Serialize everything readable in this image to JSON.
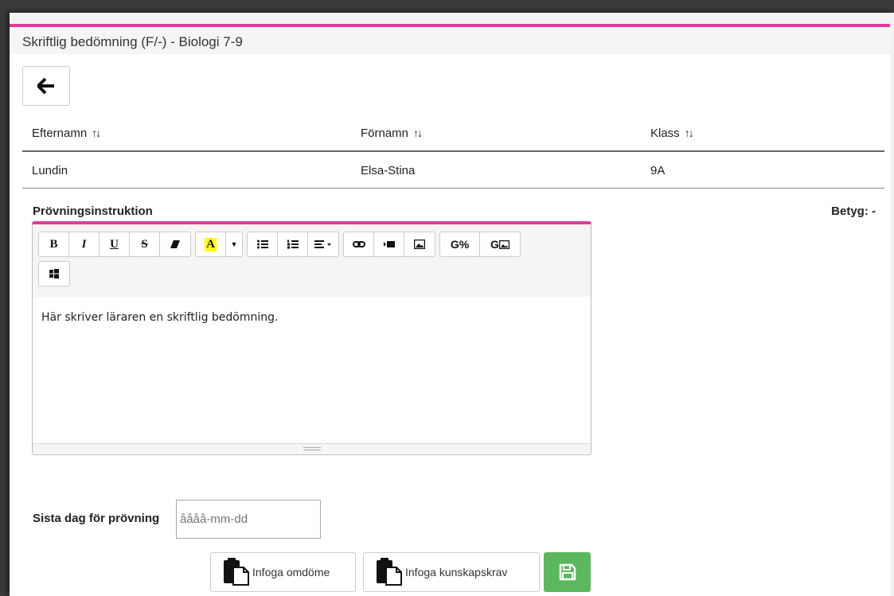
{
  "panel": {
    "title": "Skriftlig bedömning (F/-) - Biologi 7-9"
  },
  "table": {
    "headers": [
      "Efternamn",
      "Förnamn",
      "Klass"
    ],
    "rows": [
      [
        "Lundin",
        "Elsa-Stina",
        "9A"
      ]
    ]
  },
  "editor_section": {
    "label": "Prövningsinstruktion",
    "grade": "Betyg: -",
    "content": "Här skriver läraren en skriftlig bedömning.",
    "toolbar": {
      "bold": "B",
      "italic": "I",
      "underline": "U",
      "strike": "S",
      "highlight": "A",
      "icons": [
        "eraser-icon",
        "highlight-color-icon",
        "dropdown-caret-icon",
        "bullet-list-icon",
        "numbered-list-icon",
        "align-icon",
        "link-icon",
        "video-icon",
        "image-icon",
        "google-link-icon",
        "google-image-icon",
        "windows-icon"
      ]
    }
  },
  "deadline": {
    "label": "Sista dag för prövning",
    "placeholder": "åååå-mm-dd"
  },
  "actions": {
    "insert_assessment": "Infoga omdöme",
    "insert_requirements": "Infoga kunskapskrav"
  },
  "colors": {
    "accent": "#e4399c",
    "save": "#5cb85c"
  }
}
